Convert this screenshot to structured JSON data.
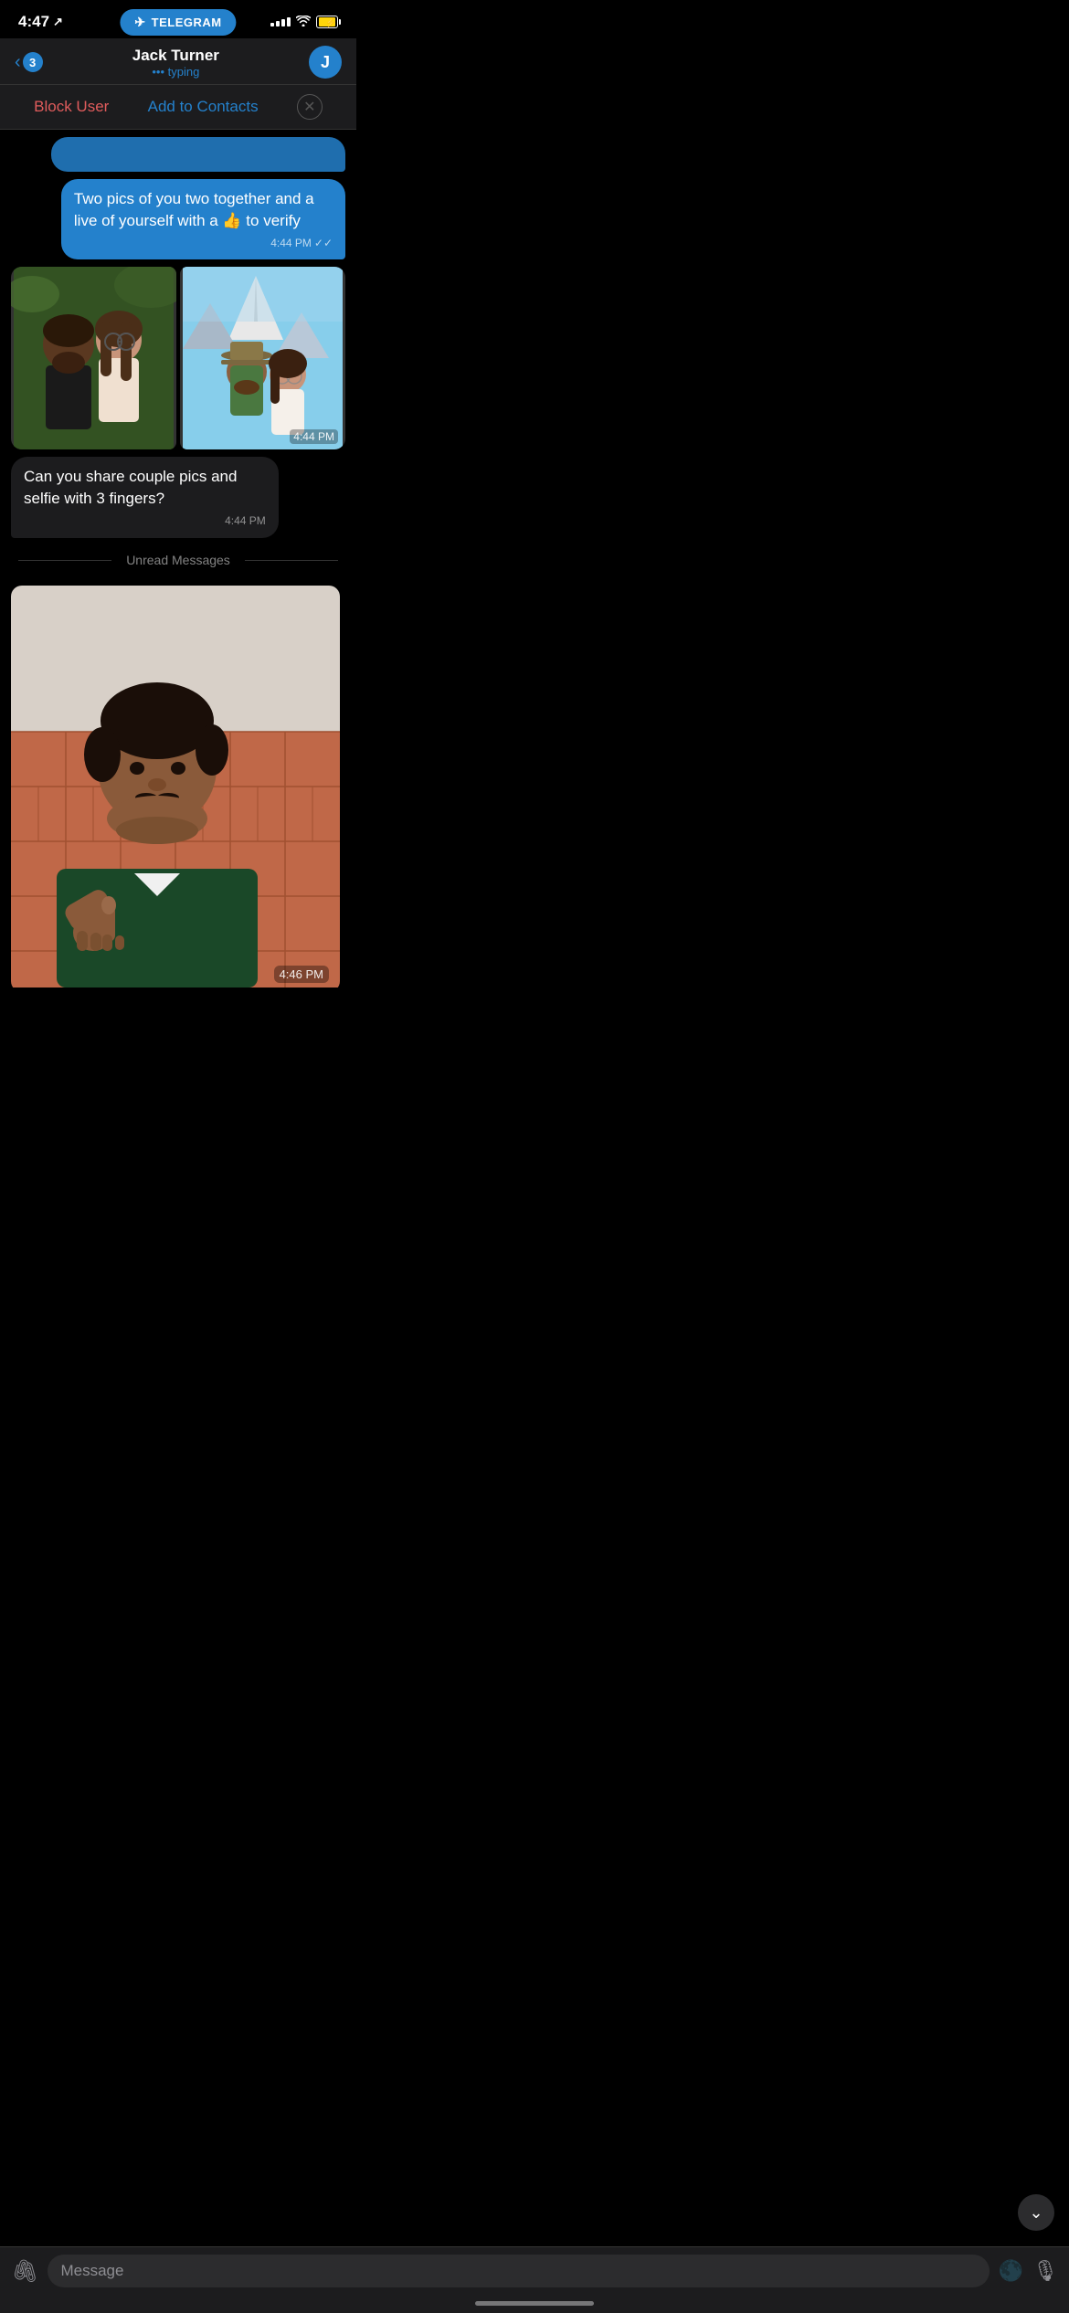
{
  "statusBar": {
    "time": "4:47",
    "locationIcon": "◀",
    "batteryCharging": true
  },
  "telegramBanner": {
    "label": "TELEGRAM"
  },
  "navBar": {
    "backLabel": "3",
    "title": "Jack Turner",
    "subtitle": "••• typing",
    "avatarLetter": "J"
  },
  "actionBar": {
    "blockLabel": "Block User",
    "addLabel": "Add to Contacts",
    "closeSymbol": "✕"
  },
  "messages": [
    {
      "id": "msg1",
      "type": "outgoing_partial",
      "time": ""
    },
    {
      "id": "msg2",
      "type": "outgoing",
      "text": "Two pics of you two together and a live of yourself with a 👍 to verify",
      "time": "4:44 PM",
      "checkmarks": "✓✓"
    },
    {
      "id": "msg3",
      "type": "photos",
      "time": "4:44 PM"
    },
    {
      "id": "msg4",
      "type": "incoming",
      "text": "Can you share couple pics and selfie with 3 fingers?",
      "time": "4:44 PM"
    }
  ],
  "unreadDivider": "Unread Messages",
  "unreadMessage": {
    "time": "4:46 PM"
  },
  "inputBar": {
    "placeholder": "Message"
  },
  "scrollDownButton": "⌄"
}
